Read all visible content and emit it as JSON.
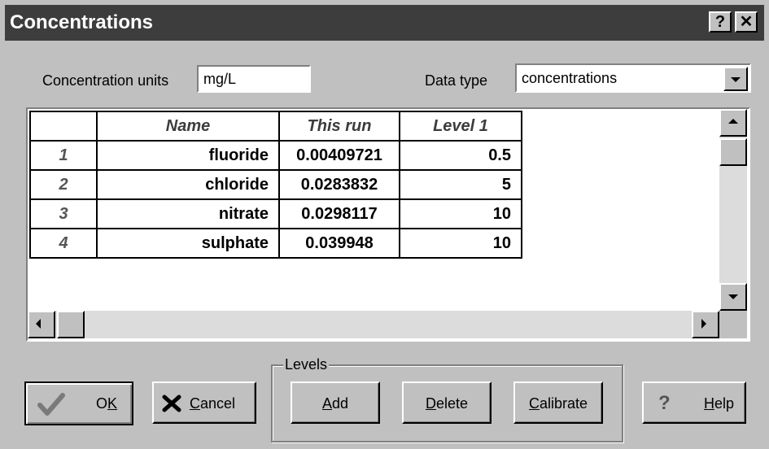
{
  "window": {
    "title": "Concentrations",
    "help_glyph": "?",
    "close_glyph": "✕"
  },
  "units": {
    "label": "Concentration units",
    "value": "mg/L"
  },
  "data_type": {
    "label": "Data type",
    "value": "concentrations"
  },
  "grid": {
    "headers": [
      "",
      "Name",
      "This run",
      "Level 1"
    ],
    "rows": [
      {
        "index": "1",
        "name": "fluoride",
        "this_run": "0.00409721",
        "level1": "0.5"
      },
      {
        "index": "2",
        "name": "chloride",
        "this_run": "0.0283832",
        "level1": "5"
      },
      {
        "index": "3",
        "name": "nitrate",
        "this_run": "0.0298117",
        "level1": "10"
      },
      {
        "index": "4",
        "name": "sulphate",
        "this_run": "0.039948",
        "level1": "10"
      }
    ]
  },
  "buttons": {
    "ok": {
      "before": "O",
      "key": "K",
      "after": ""
    },
    "cancel": {
      "before": "",
      "key": "C",
      "after": "ancel"
    },
    "add": {
      "before": "",
      "key": "A",
      "after": "dd"
    },
    "delete": {
      "before": "",
      "key": "D",
      "after": "elete"
    },
    "calibrate": {
      "before": "",
      "key": "C",
      "after": "alibrate"
    },
    "help": {
      "before": "",
      "key": "H",
      "after": "elp"
    },
    "help_glyph": "?"
  },
  "levels_group": {
    "label": "Levels"
  },
  "colors": {
    "titlebar": "#3d3d3d",
    "face": "#c0c0c0",
    "ok_check": "#7a7a7a"
  }
}
